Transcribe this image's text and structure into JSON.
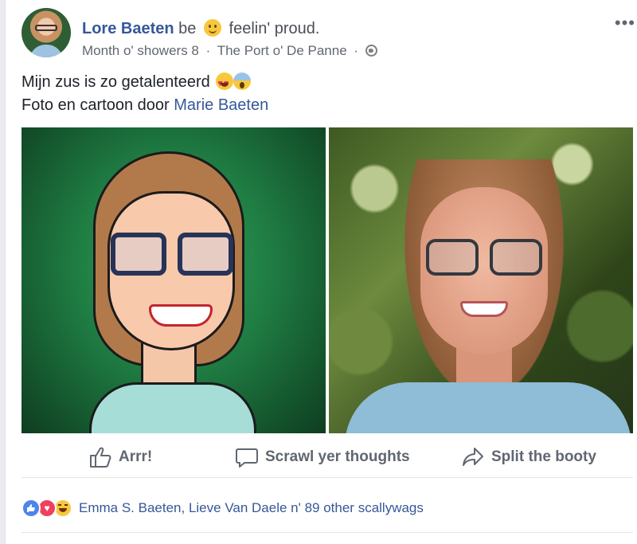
{
  "post": {
    "author": "Lore Baeten",
    "verb": "be",
    "feeling_icon": "smiling-face-emoji",
    "feeling": "feelin' proud.",
    "date": "Month o' showers 8",
    "separator": "·",
    "location": "The Port o' De Panne",
    "privacy_icon": "globe-icon",
    "more": "•••",
    "text_line1": "Mijn zus is zo getalenteerd",
    "text_line1_emojis": [
      "heart-eyes-emoji",
      "screaming-face-emoji"
    ],
    "text_line2_prefix": "Foto en cartoon door",
    "tagged": "Marie Baeten"
  },
  "photos": [
    {
      "name": "cartoon-portrait",
      "kind": "cartoon"
    },
    {
      "name": "photo-portrait",
      "kind": "photograph"
    }
  ],
  "actions": {
    "like": "Arrr!",
    "comment": "Scrawl yer thoughts",
    "share": "Split the booty"
  },
  "reactions": {
    "icons": [
      "like-reaction-icon",
      "love-reaction-icon",
      "haha-reaction-icon"
    ],
    "summary": "Emma S. Baeten, Lieve Van Daele n' 89 other scallywags"
  },
  "colors": {
    "link": "#365899",
    "meta": "#616770",
    "action": "#606770",
    "like": "#4c86e8",
    "love": "#f0405b",
    "haha": "#f7c83e"
  }
}
